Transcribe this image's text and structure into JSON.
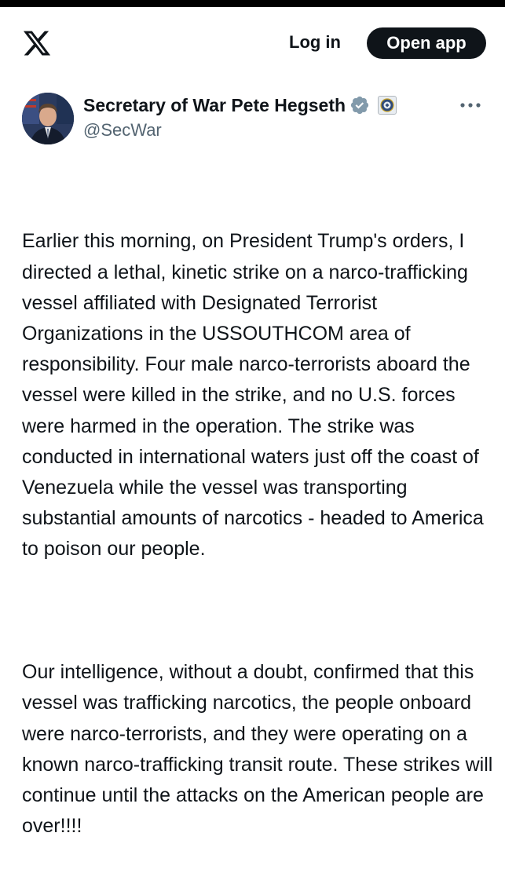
{
  "header": {
    "logo_icon": "x-logo-icon",
    "login_label": "Log in",
    "open_app_label": "Open app"
  },
  "post": {
    "display_name": "Secretary of War Pete Hegseth",
    "handle": "@SecWar",
    "verified_icon": "verified-badge-icon",
    "verified_color": "#829aab",
    "affiliation_icon": "department-seal-icon",
    "more_icon": "more-options-icon",
    "paragraphs": [
      "Earlier this morning, on President Trump's orders, I directed a lethal, kinetic strike on a narco-trafficking vessel affiliated with Designated Terrorist Organizations in the USSOUTHCOM area of responsibility. Four male narco-terrorists aboard the vessel were killed in the strike, and no U.S. forces were harmed in the operation. The strike was conducted in international waters just off the coast of Venezuela while the vessel was transporting substantial amounts of narcotics - headed to America to poison our people.",
      "Our intelligence, without a doubt, confirmed that this vessel was trafficking narcotics, the people onboard were narco-terrorists, and they were operating on a known narco-trafficking transit route. These strikes will continue until the attacks on the American people are over!!!!"
    ]
  }
}
